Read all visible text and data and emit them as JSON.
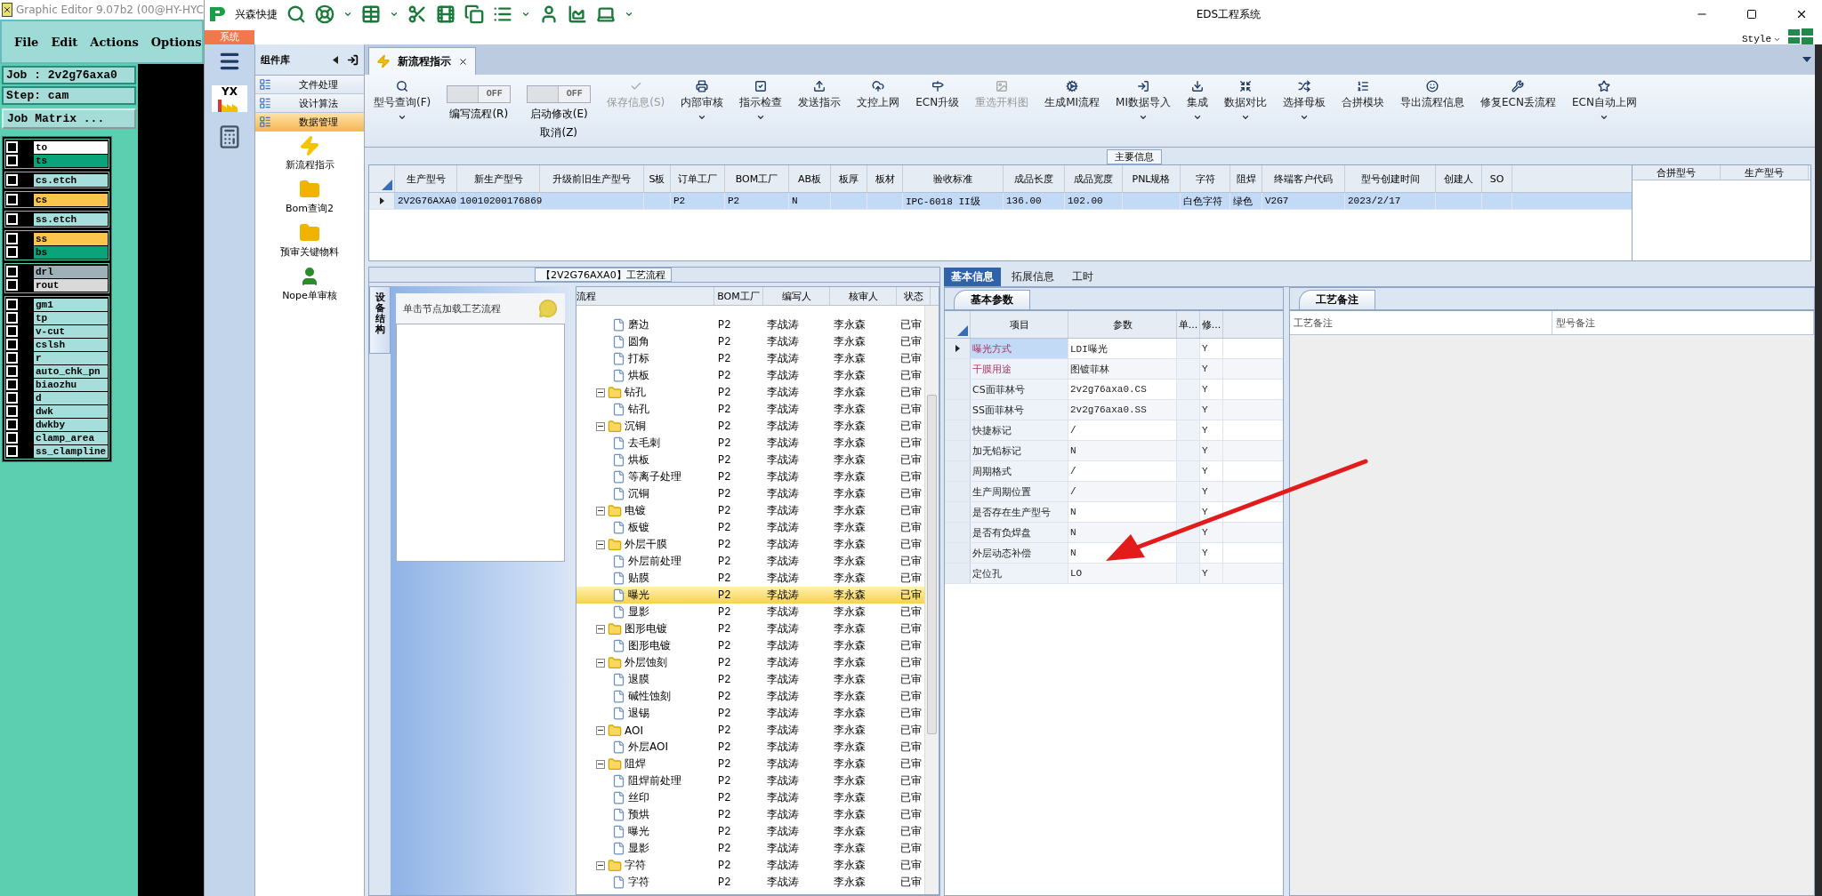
{
  "editor": {
    "title": "Graphic Editor 9.07b2 (00@HY-HYC",
    "menu": [
      "File",
      "Edit",
      "Actions",
      "Options"
    ],
    "job": "Job : 2v2g76axa0",
    "step": "Step: cam",
    "matrix_button": "Job Matrix ...",
    "layer_groups": [
      {
        "layers": [
          {
            "name": "to",
            "checked": false,
            "color": "#ffffff"
          },
          {
            "name": "ts",
            "checked": false,
            "color": "#0aa37a"
          }
        ]
      },
      {
        "layers": [
          {
            "name": "cs.etch",
            "checked": false,
            "color": "#a6dedb"
          }
        ]
      },
      {
        "layers": [
          {
            "name": "cs",
            "checked": false,
            "color": "#fbc54e"
          }
        ]
      },
      {
        "layers": [
          {
            "name": "ss.etch",
            "checked": false,
            "color": "#a6dedb"
          }
        ]
      },
      {
        "layers": [
          {
            "name": "ss",
            "checked": false,
            "color": "#fbc54e"
          },
          {
            "name": "bs",
            "checked": false,
            "color": "#0aa37a"
          }
        ]
      },
      {
        "layers": [
          {
            "name": "drl",
            "checked": false,
            "color": "#9fb1b8"
          },
          {
            "name": "rout",
            "checked": false,
            "color": "#d9d9d9"
          }
        ]
      },
      {
        "layers": [
          {
            "name": "gm1",
            "checked": false,
            "color": "#a6dedb"
          },
          {
            "name": "tp",
            "checked": false,
            "color": "#a6dedb"
          },
          {
            "name": "v-cut",
            "checked": false,
            "color": "#a6dedb"
          },
          {
            "name": "cslsh",
            "checked": false,
            "color": "#a6dedb"
          },
          {
            "name": "r",
            "checked": false,
            "color": "#a6dedb"
          },
          {
            "name": "auto_chk_pn",
            "checked": false,
            "color": "#a6dedb"
          },
          {
            "name": "biaozhu",
            "checked": false,
            "color": "#a6dedb"
          },
          {
            "name": "d",
            "checked": false,
            "color": "#a6dedb"
          },
          {
            "name": "dwk",
            "checked": false,
            "color": "#a6dedb"
          },
          {
            "name": "dwkby",
            "checked": false,
            "color": "#a6dedb"
          },
          {
            "name": "clamp_area",
            "checked": false,
            "color": "#a6dedb"
          },
          {
            "name": "ss_clampline",
            "checked": false,
            "color": "#a6dedb"
          }
        ]
      }
    ]
  },
  "app": {
    "brand": "兴森快捷",
    "title": "EDS工程系统",
    "ribbon_tab": "系统",
    "style_label": "Style"
  },
  "nav": {
    "logo": "YX"
  },
  "components": {
    "title": "组件库",
    "sections": [
      {
        "label": "文件处理",
        "selected": false
      },
      {
        "label": "设计算法",
        "selected": false
      },
      {
        "label": "数据管理",
        "selected": true
      }
    ],
    "items": [
      "新流程指示",
      "Bom查询2",
      "预审关键物料",
      "Nope单审核"
    ]
  },
  "doc_tabs": [
    {
      "label": "新流程指示",
      "selected": true
    }
  ],
  "toolbar": [
    {
      "kind": "button",
      "label": "型号查询(F)",
      "disabled": false,
      "dropdown": true
    },
    {
      "kind": "toggle",
      "label": "编写流程(R)",
      "switch_text": "OFF",
      "on": false
    },
    {
      "kind": "toggle",
      "label": "启动修改(E)",
      "second_label": "取消(Z)",
      "switch_text": "OFF",
      "on": false
    },
    {
      "kind": "button",
      "label": "保存信息(S)",
      "disabled": true,
      "dropdown": false
    },
    {
      "kind": "button",
      "label": "内部审核",
      "disabled": false,
      "dropdown": true
    },
    {
      "kind": "button",
      "label": "指示检查",
      "disabled": false,
      "dropdown": true
    },
    {
      "kind": "button",
      "label": "发送指示",
      "disabled": false,
      "dropdown": false
    },
    {
      "kind": "button",
      "label": "文控上网",
      "disabled": false,
      "dropdown": false
    },
    {
      "kind": "button",
      "label": "ECN升级",
      "disabled": false,
      "dropdown": false
    },
    {
      "kind": "button",
      "label": "重选开料图",
      "disabled": true,
      "dropdown": false
    },
    {
      "kind": "button",
      "label": "生成MI流程",
      "disabled": false,
      "dropdown": false
    },
    {
      "kind": "button",
      "label": "MI数据导入",
      "disabled": false,
      "dropdown": true
    },
    {
      "kind": "button",
      "label": "集成",
      "disabled": false,
      "dropdown": true
    },
    {
      "kind": "button",
      "label": "数据对比",
      "disabled": false,
      "dropdown": true
    },
    {
      "kind": "button",
      "label": "选择母板",
      "disabled": false,
      "dropdown": true
    },
    {
      "kind": "button",
      "label": "合拼模块",
      "disabled": false,
      "dropdown": false
    },
    {
      "kind": "button",
      "label": "导出流程信息",
      "disabled": false,
      "dropdown": false
    },
    {
      "kind": "button",
      "label": "修复ECN丢流程",
      "disabled": false,
      "dropdown": false
    },
    {
      "kind": "button",
      "label": "ECN自动上网",
      "disabled": false,
      "dropdown": true
    }
  ],
  "main_info": {
    "title": "主要信息",
    "columns": [
      "生产型号",
      "新生产型号",
      "升级前旧生产型号",
      "S板",
      "订单工厂",
      "BOM工厂",
      "AB板",
      "板厚",
      "板材",
      "验收标准",
      "成品长度",
      "成品宽度",
      "PNL规格",
      "字符",
      "阻焊",
      "终端客户代码",
      "型号创建时间",
      "创建人",
      "SO"
    ],
    "rows": [
      {
        "selected": true,
        "cells": [
          "2V2G76AXA0",
          "10010200176869",
          null,
          null,
          "P2",
          "P2",
          "N",
          null,
          null,
          "IPC-6018 II级",
          "136.00",
          "102.00",
          null,
          "白色字符",
          "绿色",
          "V2G7",
          "2023/2/17",
          null,
          null
        ]
      }
    ],
    "side_columns": [
      "合拼型号",
      "生产型号"
    ]
  },
  "flow": {
    "title": "【2V2G76AXA0】工艺流程",
    "side_tab": "设备结构",
    "hint": "单击节点加载工艺流程",
    "columns": [
      "流程",
      "BOM工厂",
      "编写人",
      "核审人",
      "状态"
    ],
    "tree": [
      {
        "children": [
          {
            "name": "磨边",
            "bom": "P2",
            "writer": "李战涛",
            "reviewer": "李永森",
            "status": "已审",
            "selected": false
          },
          {
            "name": "圆角",
            "bom": "P2",
            "writer": "李战涛",
            "reviewer": "李永森",
            "status": "已审",
            "selected": false
          },
          {
            "name": "打标",
            "bom": "P2",
            "writer": "李战涛",
            "reviewer": "李永森",
            "status": "已审",
            "selected": false
          },
          {
            "name": "烘板",
            "bom": "P2",
            "writer": "李战涛",
            "reviewer": "李永森",
            "status": "已审",
            "selected": false
          }
        ]
      },
      {
        "name": "钻孔",
        "bom": "P2",
        "writer": "李战涛",
        "reviewer": "李永森",
        "status": "已审",
        "selected": false,
        "children": [
          {
            "name": "钻孔",
            "bom": "P2",
            "writer": "李战涛",
            "reviewer": "李永森",
            "status": "已审",
            "selected": false
          }
        ]
      },
      {
        "name": "沉铜",
        "bom": "P2",
        "writer": "李战涛",
        "reviewer": "李永森",
        "status": "已审",
        "selected": false,
        "children": [
          {
            "name": "去毛刺",
            "bom": "P2",
            "writer": "李战涛",
            "reviewer": "李永森",
            "status": "已审",
            "selected": false
          },
          {
            "name": "烘板",
            "bom": "P2",
            "writer": "李战涛",
            "reviewer": "李永森",
            "status": "已审",
            "selected": false
          },
          {
            "name": "等离子处理",
            "bom": "P2",
            "writer": "李战涛",
            "reviewer": "李永森",
            "status": "已审",
            "selected": false
          },
          {
            "name": "沉铜",
            "bom": "P2",
            "writer": "李战涛",
            "reviewer": "李永森",
            "status": "已审",
            "selected": false
          }
        ]
      },
      {
        "name": "电镀",
        "bom": "P2",
        "writer": "李战涛",
        "reviewer": "李永森",
        "status": "已审",
        "selected": false,
        "children": [
          {
            "name": "板镀",
            "bom": "P2",
            "writer": "李战涛",
            "reviewer": "李永森",
            "status": "已审",
            "selected": false
          }
        ]
      },
      {
        "name": "外层干膜",
        "bom": "P2",
        "writer": "李战涛",
        "reviewer": "李永森",
        "status": "已审",
        "selected": false,
        "children": [
          {
            "name": "外层前处理",
            "bom": "P2",
            "writer": "李战涛",
            "reviewer": "李永森",
            "status": "已审",
            "selected": false
          },
          {
            "name": "贴膜",
            "bom": "P2",
            "writer": "李战涛",
            "reviewer": "李永森",
            "status": "已审",
            "selected": false
          },
          {
            "name": "曝光",
            "bom": "P2",
            "writer": "李战涛",
            "reviewer": "李永森",
            "status": "已审",
            "selected": true
          },
          {
            "name": "显影",
            "bom": "P2",
            "writer": "李战涛",
            "reviewer": "李永森",
            "status": "已审",
            "selected": false
          }
        ]
      },
      {
        "name": "图形电镀",
        "bom": "P2",
        "writer": "李战涛",
        "reviewer": "李永森",
        "status": "已审",
        "selected": false,
        "children": [
          {
            "name": "图形电镀",
            "bom": "P2",
            "writer": "李战涛",
            "reviewer": "李永森",
            "status": "已审",
            "selected": false
          }
        ]
      },
      {
        "name": "外层蚀刻",
        "bom": "P2",
        "writer": "李战涛",
        "reviewer": "李永森",
        "status": "已审",
        "selected": false,
        "children": [
          {
            "name": "退膜",
            "bom": "P2",
            "writer": "李战涛",
            "reviewer": "李永森",
            "status": "已审",
            "selected": false
          },
          {
            "name": "碱性蚀刻",
            "bom": "P2",
            "writer": "李战涛",
            "reviewer": "李永森",
            "status": "已审",
            "selected": false
          },
          {
            "name": "退锡",
            "bom": "P2",
            "writer": "李战涛",
            "reviewer": "李永森",
            "status": "已审",
            "selected": false
          }
        ]
      },
      {
        "name": "AOI",
        "bom": "P2",
        "writer": "李战涛",
        "reviewer": "李永森",
        "status": "已审",
        "selected": false,
        "children": [
          {
            "name": "外层AOI",
            "bom": "P2",
            "writer": "李战涛",
            "reviewer": "李永森",
            "status": "已审",
            "selected": false
          }
        ]
      },
      {
        "name": "阻焊",
        "bom": "P2",
        "writer": "李战涛",
        "reviewer": "李永森",
        "status": "已审",
        "selected": false,
        "children": [
          {
            "name": "阻焊前处理",
            "bom": "P2",
            "writer": "李战涛",
            "reviewer": "李永森",
            "status": "已审",
            "selected": false
          },
          {
            "name": "丝印",
            "bom": "P2",
            "writer": "李战涛",
            "reviewer": "李永森",
            "status": "已审",
            "selected": false
          },
          {
            "name": "预烘",
            "bom": "P2",
            "writer": "李战涛",
            "reviewer": "李永森",
            "status": "已审",
            "selected": false
          },
          {
            "name": "曝光",
            "bom": "P2",
            "writer": "李战涛",
            "reviewer": "李永森",
            "status": "已审",
            "selected": false
          },
          {
            "name": "显影",
            "bom": "P2",
            "writer": "李战涛",
            "reviewer": "李永森",
            "status": "已审",
            "selected": false
          }
        ]
      },
      {
        "name": "字符",
        "bom": "P2",
        "writer": "李战涛",
        "reviewer": "李永森",
        "status": "已审",
        "selected": false,
        "children": [
          {
            "name": "字符",
            "bom": "P2",
            "writer": "李战涛",
            "reviewer": "李永森",
            "status": "已审",
            "selected": false
          }
        ]
      }
    ]
  },
  "details": {
    "tabs": [
      {
        "label": "基本信息",
        "selected": true
      },
      {
        "label": "拓展信息",
        "selected": false
      },
      {
        "label": "工时",
        "selected": false
      }
    ],
    "params": {
      "tab": "基本参数",
      "columns": [
        "项目",
        "参数",
        "单...",
        "修..."
      ],
      "rows": [
        {
          "item": "曝光方式",
          "value": "LDI曝光",
          "modifiable": "Y",
          "flagged": true,
          "selected": true
        },
        {
          "item": "干膜用途",
          "value": "图镀菲林",
          "modifiable": "Y",
          "flagged": true,
          "selected": false
        },
        {
          "item": "CS面菲林号",
          "value": "2v2g76axa0.CS",
          "modifiable": "Y",
          "flagged": false,
          "selected": false
        },
        {
          "item": "SS面菲林号",
          "value": "2v2g76axa0.SS",
          "modifiable": "Y",
          "flagged": false,
          "selected": false
        },
        {
          "item": "快捷标记",
          "value": "/",
          "modifiable": "Y",
          "flagged": false,
          "selected": false
        },
        {
          "item": "加无铅标记",
          "value": "N",
          "modifiable": "Y",
          "flagged": false,
          "selected": false
        },
        {
          "item": "周期格式",
          "value": "/",
          "modifiable": "Y",
          "flagged": false,
          "selected": false
        },
        {
          "item": "生产周期位置",
          "value": "/",
          "modifiable": "Y",
          "flagged": false,
          "selected": false
        },
        {
          "item": "是否存在生产型号",
          "value": "N",
          "modifiable": "Y",
          "flagged": false,
          "selected": false
        },
        {
          "item": "是否有负焊盘",
          "value": "N",
          "modifiable": "Y",
          "flagged": false,
          "selected": false
        },
        {
          "item": "外层动态补偿",
          "value": "N",
          "modifiable": "Y",
          "flagged": false,
          "selected": false
        },
        {
          "item": "定位孔",
          "value": "LO",
          "modifiable": "Y",
          "flagged": false,
          "selected": false
        }
      ]
    },
    "notes": {
      "tab": "工艺备注",
      "columns": [
        "工艺备注",
        "型号备注"
      ]
    }
  },
  "annotations": [
    {
      "kind": "arrow"
    }
  ]
}
